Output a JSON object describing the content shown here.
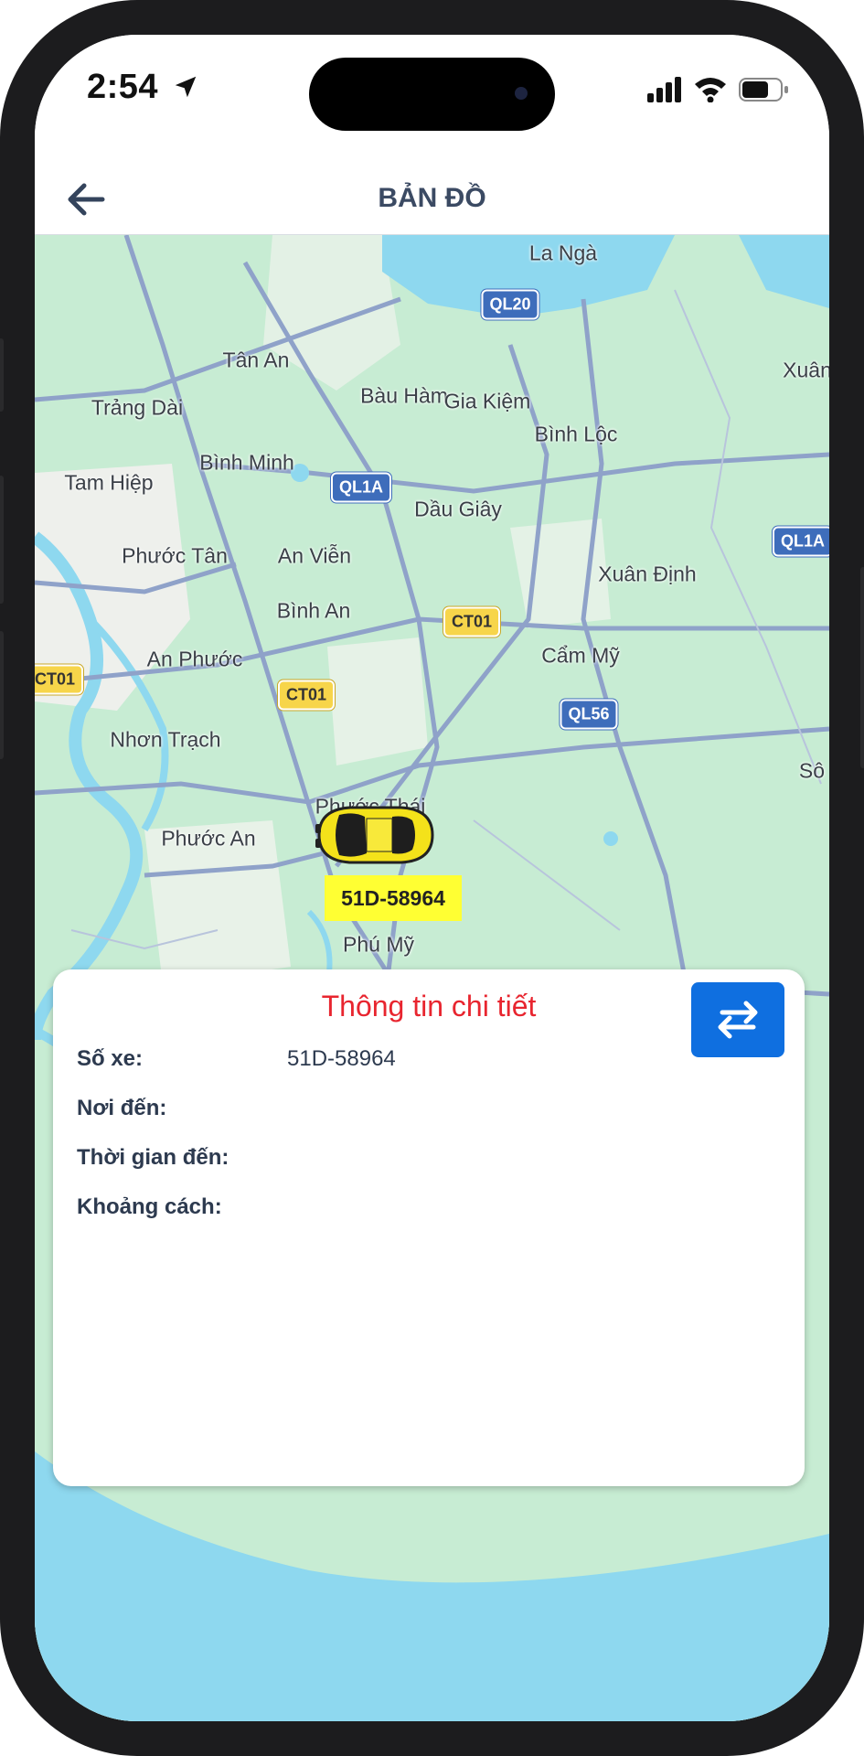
{
  "status_bar": {
    "time": "2:54"
  },
  "header": {
    "title": "BẢN ĐỒ",
    "back_icon": "arrow-left-icon"
  },
  "map": {
    "places": {
      "la_nga": "La Ngà",
      "tan_an": "Tân An",
      "xuan": "Xuân",
      "trang_dai": "Trảng Dài",
      "bau_ham": "Bàu Hàm",
      "gia_kiem": "Gia Kiệm",
      "binh_loc": "Bình Lộc",
      "binh_minh": "Bình Minh",
      "tam_hiep": "Tam Hiệp",
      "dau_giay": "Dầu Giây",
      "phuoc_tan": "Phước Tân",
      "an_vien": "An Viễn",
      "xuan_dinh": "Xuân Định",
      "binh_an": "Bình An",
      "an_phuoc": "An Phước",
      "cam_my": "Cẩm Mỹ",
      "nhon_trach": "Nhơn Trạch",
      "so": "Sô",
      "phuoc_thai": "Phước Thái",
      "phuoc_an": "Phước An",
      "phu_my": "Phú Mỹ"
    },
    "shields": {
      "ql20": "QL20",
      "ql1a_center": "QL1A",
      "ql1a_right": "QL1A",
      "ct01_right": "CT01",
      "ct01_left": "CT01",
      "ct01_center": "CT01",
      "ql56": "QL56"
    },
    "vehicle_plate": "51D-58964",
    "colors": {
      "land": "#c7ecd3",
      "water": "#8ed8ef",
      "road": "#8fa2c9",
      "urban": "#eef0ec"
    }
  },
  "panel": {
    "title": "Thông tin chi tiết",
    "swap_icon": "swap-arrows-icon",
    "rows": [
      {
        "label": "Số xe:",
        "value": "51D-58964"
      },
      {
        "label": "Nơi đến:",
        "value": ""
      },
      {
        "label": "Thời gian đến:",
        "value": ""
      },
      {
        "label": "Khoảng cách:",
        "value": ""
      }
    ]
  }
}
